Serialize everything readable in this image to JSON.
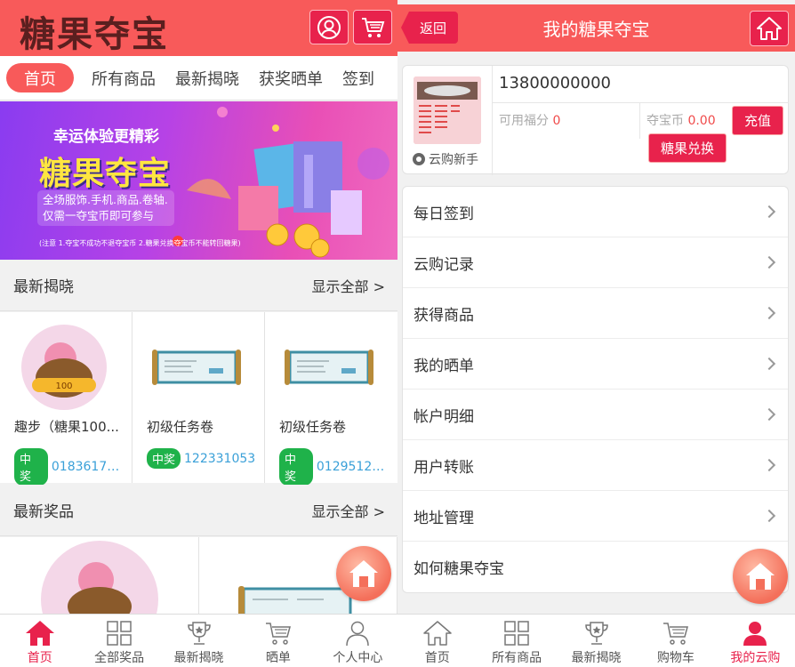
{
  "left": {
    "logo": "糖果夺宝",
    "tabs": [
      "首页",
      "所有商品",
      "最新揭晓",
      "获奖晒单",
      "签到"
    ],
    "banner": {
      "line1": "幸运体验更精彩",
      "line2": "糖果夺宝",
      "line3a": "全场服饰.手机.商品.卷轴.",
      "line3b": "仅需一夺宝币即可参与",
      "note": "(注意 1.夺宝不成功不退夺宝币 2.糖果兑换夺宝币不能转回糖果)"
    },
    "section_latest": {
      "title": "最新揭晓",
      "more": "显示全部 >"
    },
    "latest_items": [
      {
        "name": "趣步（糖果100...",
        "badge": "中奖",
        "code": "01836170..."
      },
      {
        "name": "初级任务卷",
        "badge": "中奖",
        "code": "122331053"
      },
      {
        "name": "初级任务卷",
        "badge": "中奖",
        "code": "01295123..."
      }
    ],
    "section_prizes": {
      "title": "最新奖品",
      "more": "显示全部 >"
    },
    "bottom_nav": [
      "首页",
      "全部奖品",
      "最新揭晓",
      "晒单",
      "个人中心"
    ]
  },
  "right": {
    "back": "返回",
    "title": "我的糖果夺宝",
    "profile": {
      "phone": "13800000000",
      "level": "云购新手",
      "fufen_label": "可用福分",
      "fufen_value": "0",
      "coin_label": "夺宝币",
      "coin_value": "0.00",
      "recharge": "充值",
      "exchange": "糖果兑换"
    },
    "menu": [
      "每日签到",
      "云购记录",
      "获得商品",
      "我的晒单",
      "帐户明细",
      "用户转账",
      "地址管理",
      "如何糖果夺宝"
    ],
    "bottom_nav": [
      "首页",
      "所有商品",
      "最新揭晓",
      "购物车",
      "我的云购"
    ]
  },
  "colors": {
    "header": "#f85a5a",
    "accent": "#e8224c",
    "win_badge": "#1fb24a",
    "code_link": "#3aa0d8"
  }
}
